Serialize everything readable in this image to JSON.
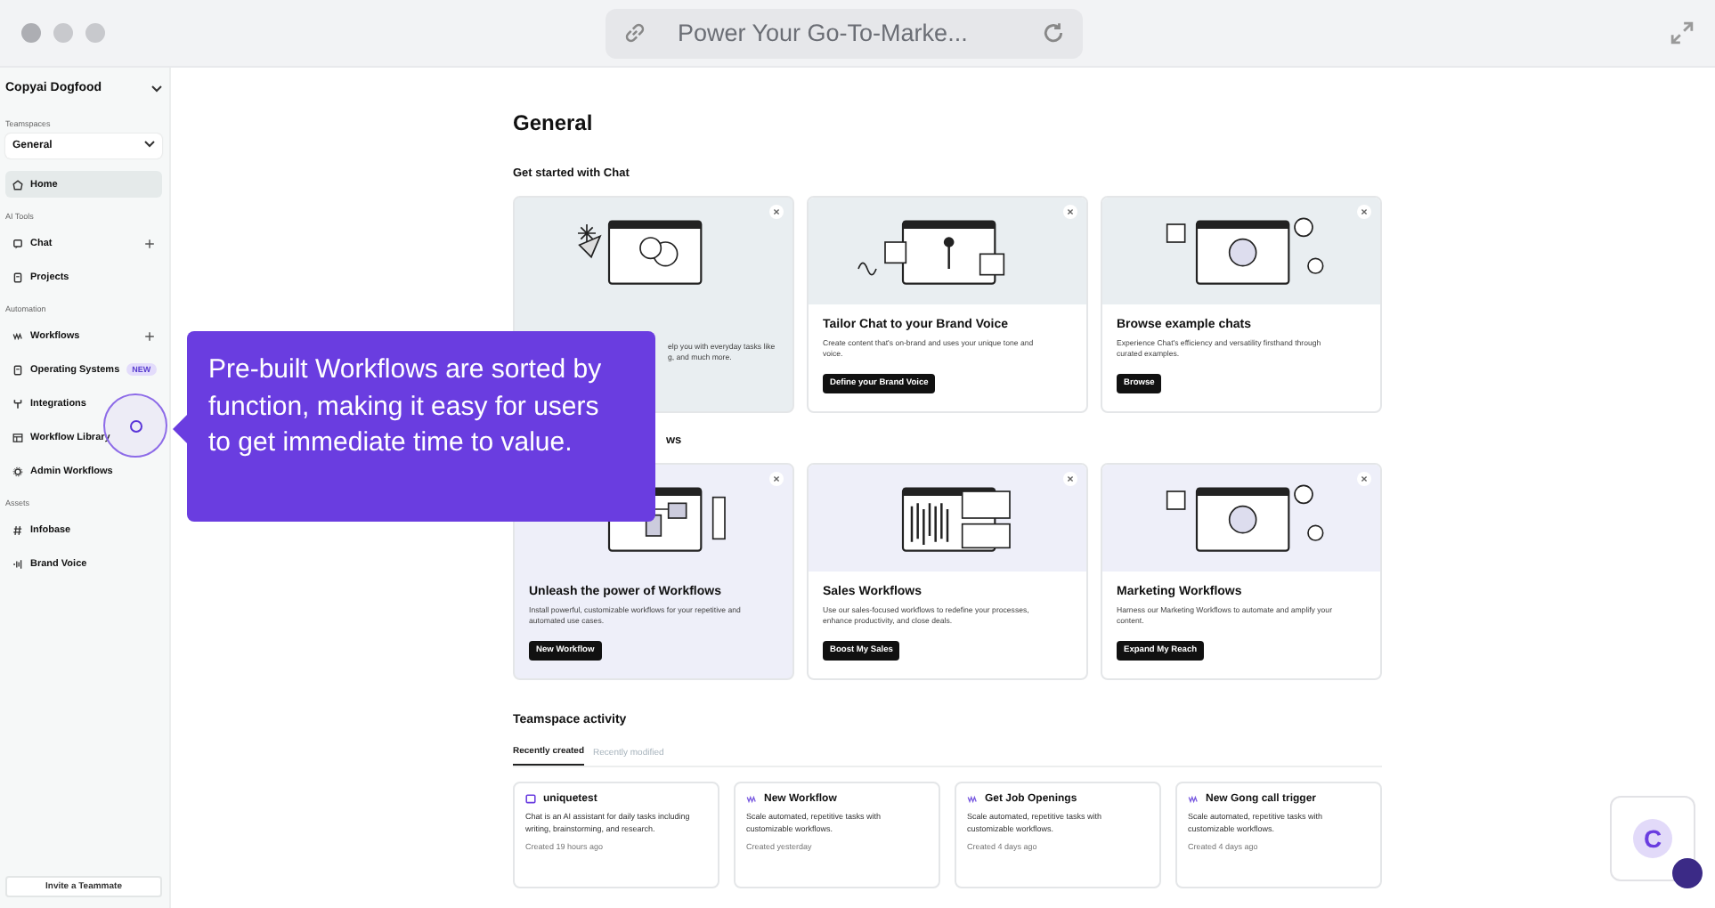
{
  "browser": {
    "address": "Power Your Go-To-Marke..."
  },
  "sidebar": {
    "workspace": "Copyai Dogfood",
    "teamspace_label": "Teamspaces",
    "teamspace": "General",
    "sections": [
      {
        "items": [
          {
            "label": "Home",
            "selected": true,
            "add": false
          }
        ]
      },
      {
        "label": "AI Tools",
        "items": [
          {
            "label": "Chat",
            "selected": false,
            "add": true
          },
          {
            "label": "Projects",
            "selected": false,
            "add": false
          }
        ]
      },
      {
        "label": "Automation",
        "items": [
          {
            "label": "Workflows",
            "selected": false,
            "add": true
          },
          {
            "label": "Operating Systems",
            "selected": false,
            "add": false,
            "badge": "NEW"
          },
          {
            "label": "Integrations",
            "selected": false,
            "add": false
          },
          {
            "label": "Workflow Library",
            "selected": false,
            "add": false
          },
          {
            "label": "Admin Workflows",
            "selected": false,
            "add": false
          }
        ]
      },
      {
        "label": "Assets",
        "items": [
          {
            "label": "Infobase",
            "selected": false,
            "add": false
          },
          {
            "label": "Brand Voice",
            "selected": false,
            "add": false
          }
        ]
      }
    ],
    "invite": "Invite a Teammate"
  },
  "page": {
    "title": "General",
    "sections": [
      {
        "heading": "Get started with Chat",
        "cards": [
          {
            "description": [
              "elp you with everyday tasks like",
              "g, and much more."
            ],
            "hovered": true
          },
          {
            "title": "Tailor Chat to your Brand Voice",
            "description": [
              "Create content that's on-brand and uses your unique tone and",
              "voice."
            ],
            "button": "Define your Brand Voice",
            "hovered": false
          },
          {
            "title": "Browse example chats",
            "description": [
              "Experience Chat's efficiency and versatility firsthand through",
              "curated examples."
            ],
            "button": "Browse",
            "hovered": false
          }
        ]
      },
      {
        "heading": "ws",
        "cards": [
          {
            "title": "Unleash the power of Workflows",
            "description": [
              "Install powerful, customizable workflows for your repetitive and",
              "automated use cases."
            ],
            "button": "New Workflow",
            "hovered": true
          },
          {
            "title": "Sales Workflows",
            "description": [
              "Use our sales-focused workflows to redefine your processes,",
              "enhance productivity, and close deals."
            ],
            "button": "Boost My Sales",
            "hovered": false
          },
          {
            "title": "Marketing Workflows",
            "description": [
              "Harness our Marketing Workflows to automate and amplify your",
              "content."
            ],
            "button": "Expand My Reach",
            "hovered": false
          }
        ]
      }
    ],
    "activity": {
      "heading": "Teamspace activity",
      "tabs": [
        {
          "label": "Recently created",
          "selected": true
        },
        {
          "label": "Recently modified",
          "selected": false
        }
      ],
      "items": [
        {
          "kind": "chat",
          "title": "uniquetest",
          "description": "Chat is an AI assistant for daily tasks including writing, brainstorming, and research.",
          "meta": "Created 19 hours ago"
        },
        {
          "kind": "workflow",
          "title": "New Workflow",
          "description": "Scale automated, repetitive tasks with customizable workflows.",
          "meta": "Created yesterday"
        },
        {
          "kind": "workflow",
          "title": "Get Job Openings",
          "description": "Scale automated, repetitive tasks with customizable workflows.",
          "meta": "Created 4 days ago"
        },
        {
          "kind": "workflow",
          "title": "New Gong call trigger",
          "description": "Scale automated, repetitive tasks with customizable workflows.",
          "meta": "Created 4 days ago"
        }
      ]
    }
  },
  "tooltip": {
    "text": "Pre-built Workflows are sorted by function, making it easy for users to get immediate time to value."
  },
  "launcher": {
    "label": "C"
  }
}
